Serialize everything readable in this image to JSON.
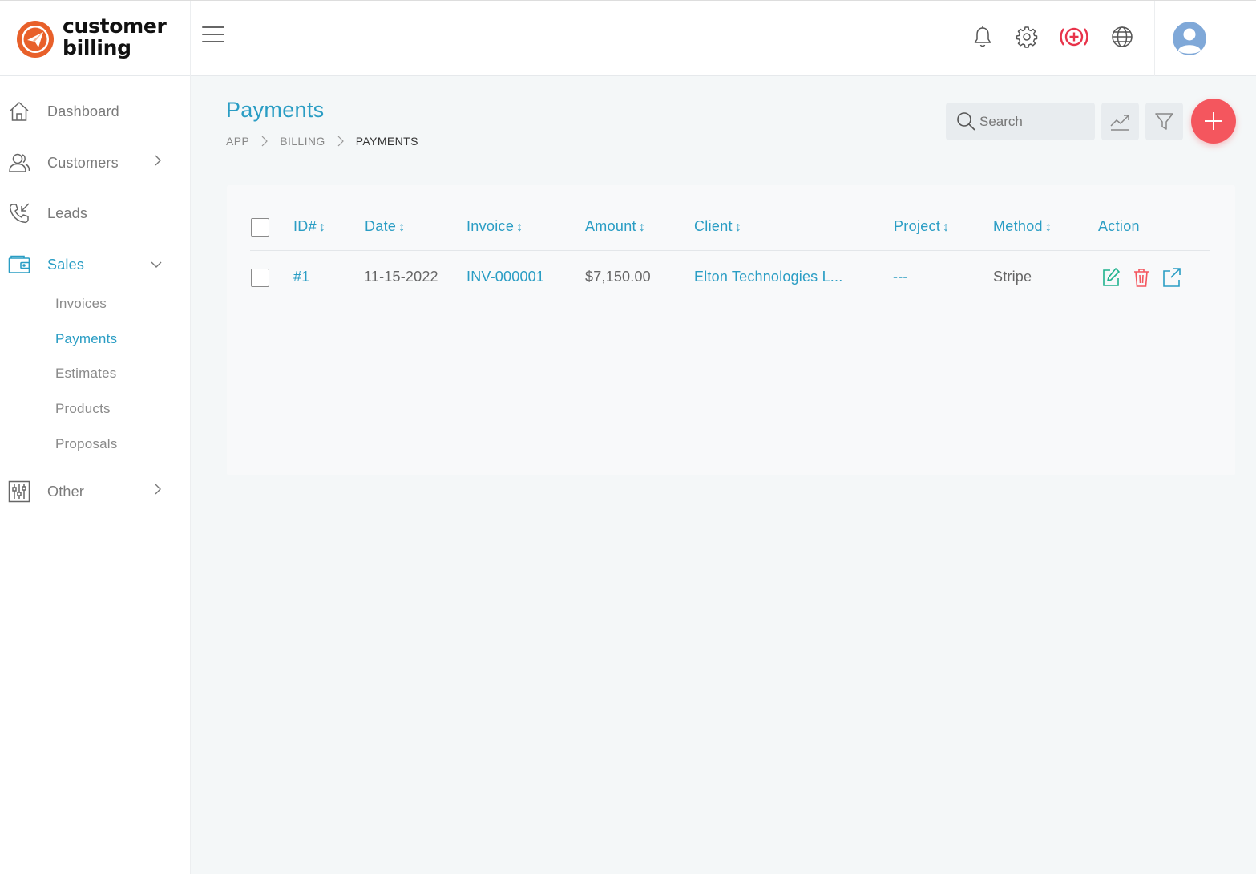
{
  "brand": {
    "line1": "customer",
    "line2": "billing"
  },
  "header": {
    "icons": [
      "bell-icon",
      "gear-icon",
      "add-circle-icon",
      "globe-icon",
      "user-avatar"
    ],
    "accent": "#2a9dc4",
    "danger": "#f4565e"
  },
  "sidebar": {
    "items": [
      {
        "label": "Dashboard",
        "icon": "home-icon"
      },
      {
        "label": "Customers",
        "icon": "users-icon"
      },
      {
        "label": "Leads",
        "icon": "phone-icon"
      },
      {
        "label": "Sales",
        "icon": "wallet-icon",
        "expanded": true
      },
      {
        "label": "Other",
        "icon": "sliders-icon"
      }
    ],
    "sales_sub": [
      {
        "label": "Invoices"
      },
      {
        "label": "Payments",
        "active": true
      },
      {
        "label": "Estimates"
      },
      {
        "label": "Products"
      },
      {
        "label": "Proposals"
      }
    ]
  },
  "page": {
    "title": "Payments",
    "breadcrumb": [
      "APP",
      "BILLING",
      "PAYMENTS"
    ]
  },
  "toolbar": {
    "search_placeholder": "Search"
  },
  "table": {
    "sort_glyph": "↕",
    "columns": [
      "ID#",
      "Date",
      "Invoice",
      "Amount",
      "Client",
      "Project",
      "Method",
      "Action"
    ],
    "rows": [
      {
        "id": "#1",
        "date": "11-15-2022",
        "invoice": "INV-000001",
        "amount": "$7,150.00",
        "client": "Elton Technologies L...",
        "project": "---",
        "method": "Stripe"
      }
    ]
  }
}
